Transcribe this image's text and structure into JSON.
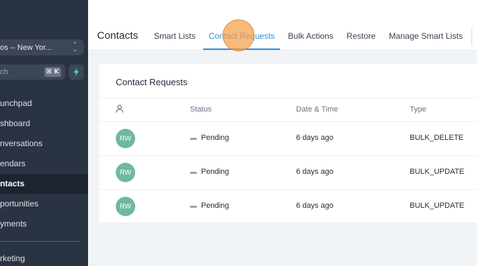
{
  "sidebar": {
    "location": "os -- New Yor...",
    "search_placeholder": "ch",
    "search_shortcut": "⌘ K",
    "nav_items": [
      {
        "label": "unchpad",
        "active": false
      },
      {
        "label": "shboard",
        "active": false
      },
      {
        "label": "nversations",
        "active": false
      },
      {
        "label": "endars",
        "active": false
      },
      {
        "label": "ntacts",
        "active": true
      },
      {
        "label": "portunities",
        "active": false
      },
      {
        "label": "yments",
        "active": false
      }
    ],
    "bottom_item": "rketing"
  },
  "header": {
    "title": "Contacts",
    "tabs": [
      {
        "label": "Smart Lists",
        "active": false
      },
      {
        "label": "Contact Requests",
        "active": true
      },
      {
        "label": "Bulk Actions",
        "active": false
      },
      {
        "label": "Restore",
        "active": false
      },
      {
        "label": "Manage Smart Lists",
        "active": false
      }
    ]
  },
  "card": {
    "title": "Contact Requests",
    "columns": {
      "user_icon": "user-icon",
      "status": "Status",
      "datetime": "Date & Time",
      "type": "Type"
    },
    "rows": [
      {
        "avatar": "RW",
        "status": "Pending",
        "datetime": "6 days ago",
        "type": "BULK_DELETE"
      },
      {
        "avatar": "RW",
        "status": "Pending",
        "datetime": "6 days ago",
        "type": "BULK_UPDATE"
      },
      {
        "avatar": "RW",
        "status": "Pending",
        "datetime": "6 days ago",
        "type": "BULK_UPDATE"
      }
    ]
  },
  "colors": {
    "sidebar_bg": "#2a3342",
    "accent": "#2f8fd6",
    "avatar_bg": "#6fb99c",
    "bolt": "#3ddc97"
  }
}
